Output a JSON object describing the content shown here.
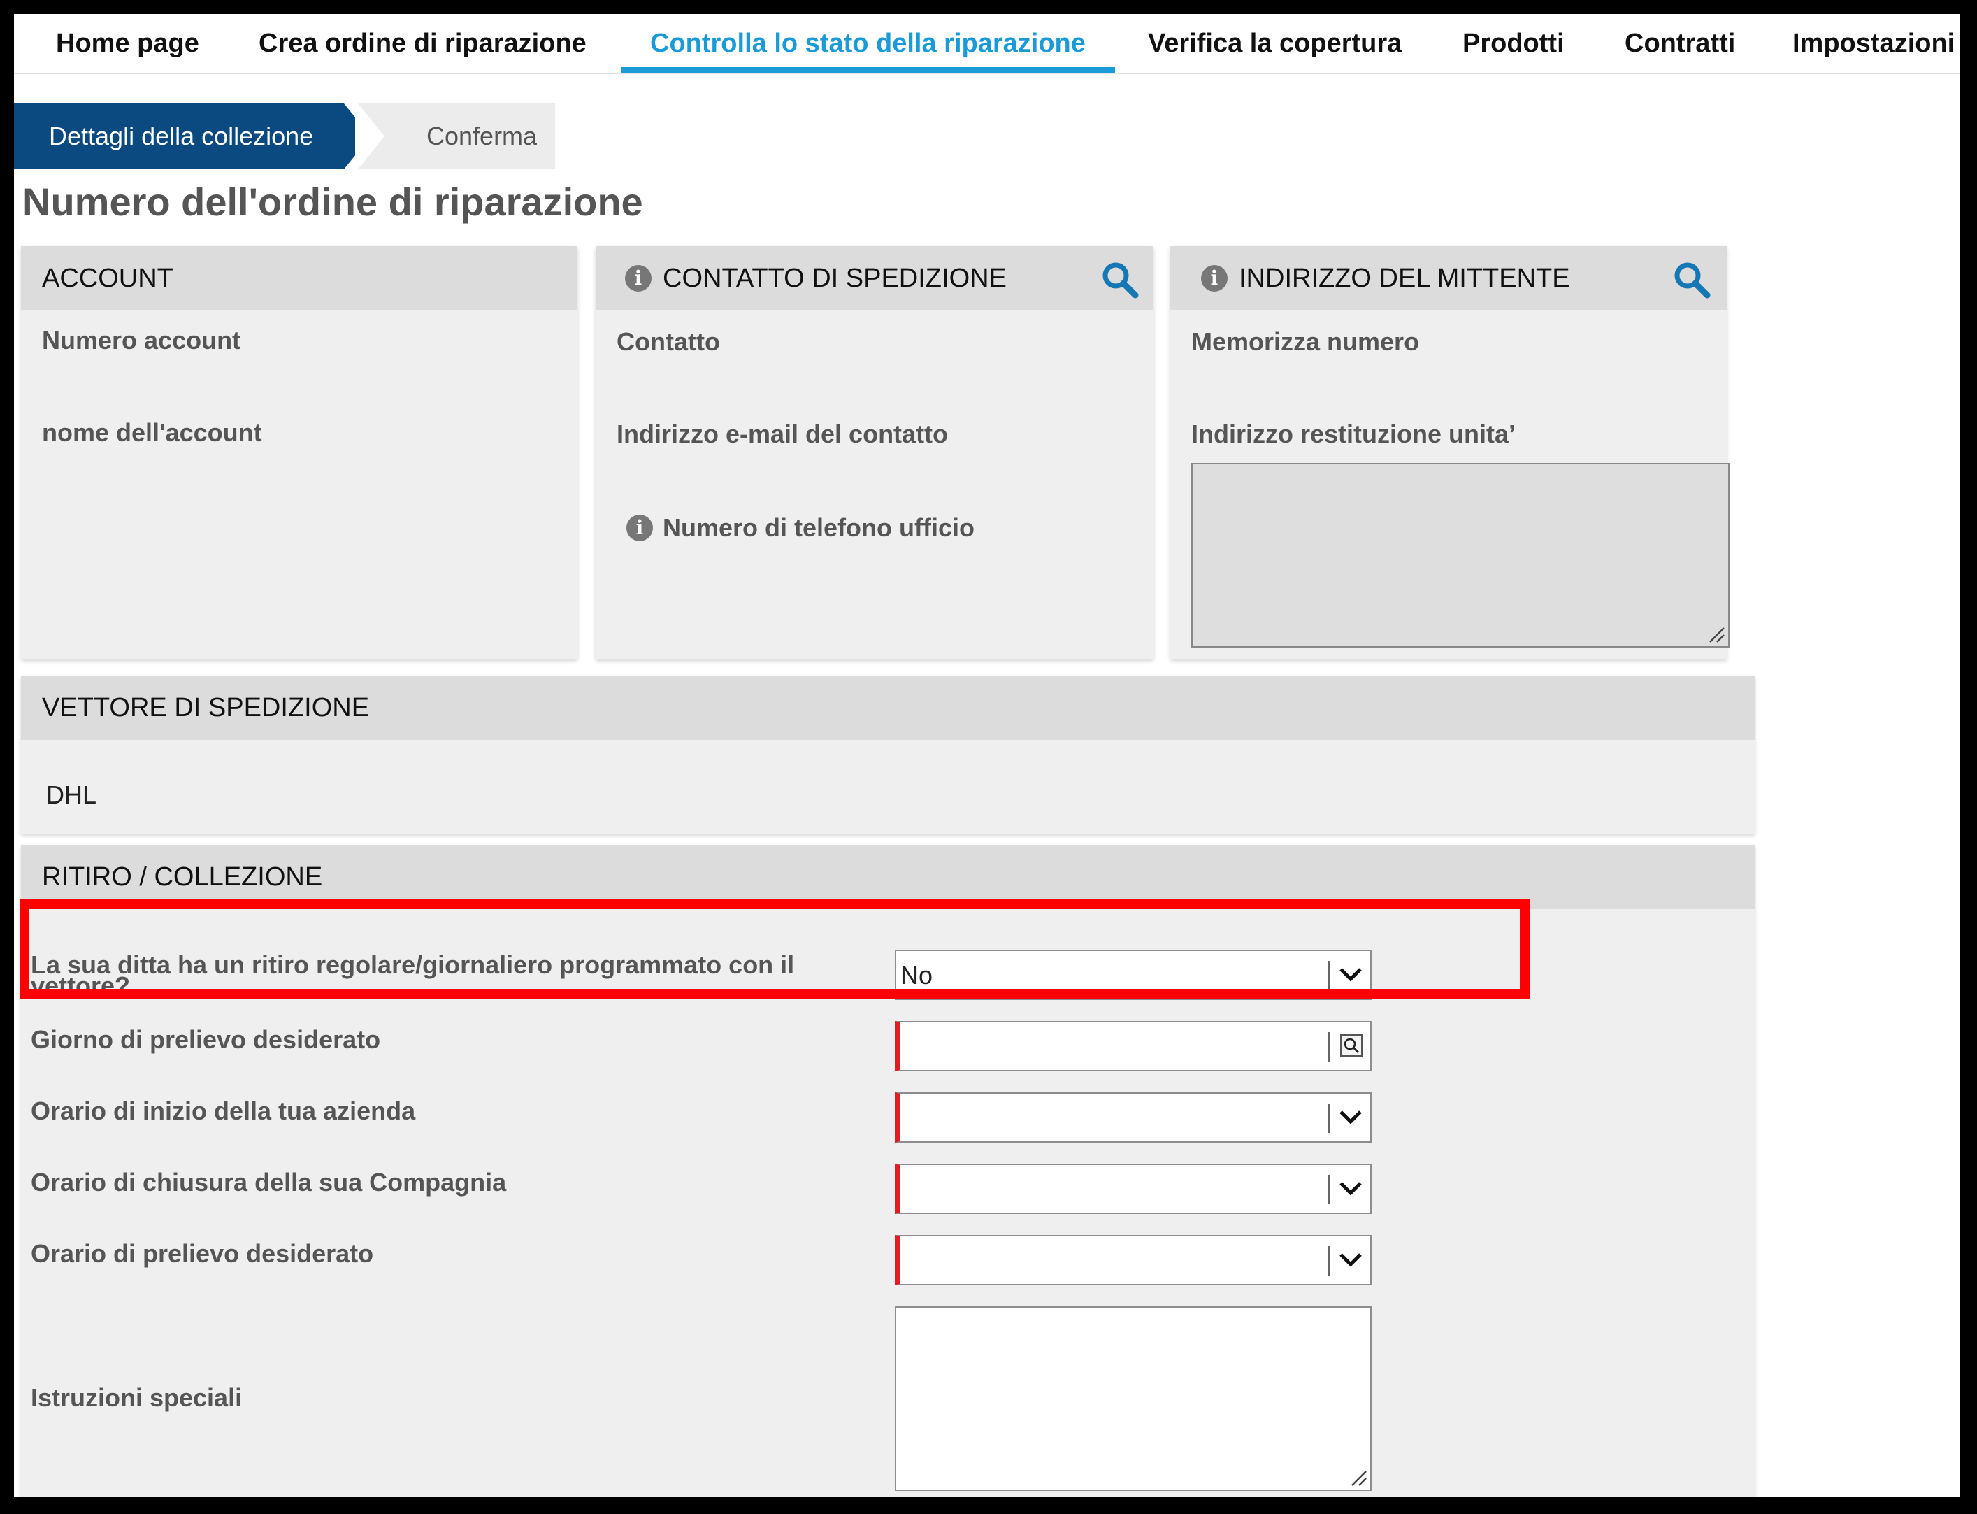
{
  "nav": {
    "items": [
      {
        "label": "Home page"
      },
      {
        "label": "Crea ordine di riparazione"
      },
      {
        "label": "Controlla lo stato della riparazione"
      },
      {
        "label": "Verifica la copertura"
      },
      {
        "label": "Prodotti"
      },
      {
        "label": "Contratti"
      },
      {
        "label": "Impostazioni"
      }
    ],
    "active_index": 2
  },
  "wizard": {
    "steps": [
      {
        "label": "Dettagli della collezione",
        "state": "active"
      },
      {
        "label": "Conferma",
        "state": "inactive"
      }
    ]
  },
  "page_title": "Numero dell'ordine di riparazione",
  "account_panel": {
    "title": "ACCOUNT",
    "fields": [
      "Numero account",
      "nome dell'account"
    ]
  },
  "contact_panel": {
    "title": "CONTATTO DI SPEDIZIONE",
    "fields": [
      "Contatto",
      "Indirizzo e-mail del contatto",
      "Numero di telefono ufficio"
    ]
  },
  "sender_panel": {
    "title": "INDIRIZZO DEL MITTENTE",
    "fields": [
      "Memorizza numero",
      "Indirizzo restituzione unita’"
    ]
  },
  "carrier_panel": {
    "title": "VETTORE DI SPEDIZIONE",
    "value": "DHL"
  },
  "pickup_panel": {
    "title": "RITIRO / COLLEZIONE",
    "regular_pickup": {
      "label_line1": "La sua ditta ha un ritiro regolare/giornaliero programmato con il",
      "label_line2": "vettore?",
      "value": "No"
    },
    "pickup_day": {
      "label": "Giorno di prelievo desiderato",
      "value": ""
    },
    "start_time": {
      "label": "Orario di inizio della tua azienda",
      "value": ""
    },
    "close_time": {
      "label": "Orario di chiusura della sua Compagnia",
      "value": ""
    },
    "pickup_time": {
      "label": "Orario di prelievo desiderato",
      "value": ""
    },
    "special_instructions": {
      "label": "Istruzioni speciali",
      "value": ""
    }
  },
  "colors": {
    "accent": "#1a9bd7",
    "wizard_active": "#0b4a80",
    "required_marker": "#e31b23",
    "highlight": "#ff0000",
    "panel_bg": "#efefef",
    "panel_header": "#dcdcdc"
  },
  "icons": {
    "info": "info-icon",
    "search": "search-icon",
    "dropdown": "chevron-down-icon",
    "date_picker": "date-picker-icon",
    "resize": "resize-grip-icon"
  }
}
